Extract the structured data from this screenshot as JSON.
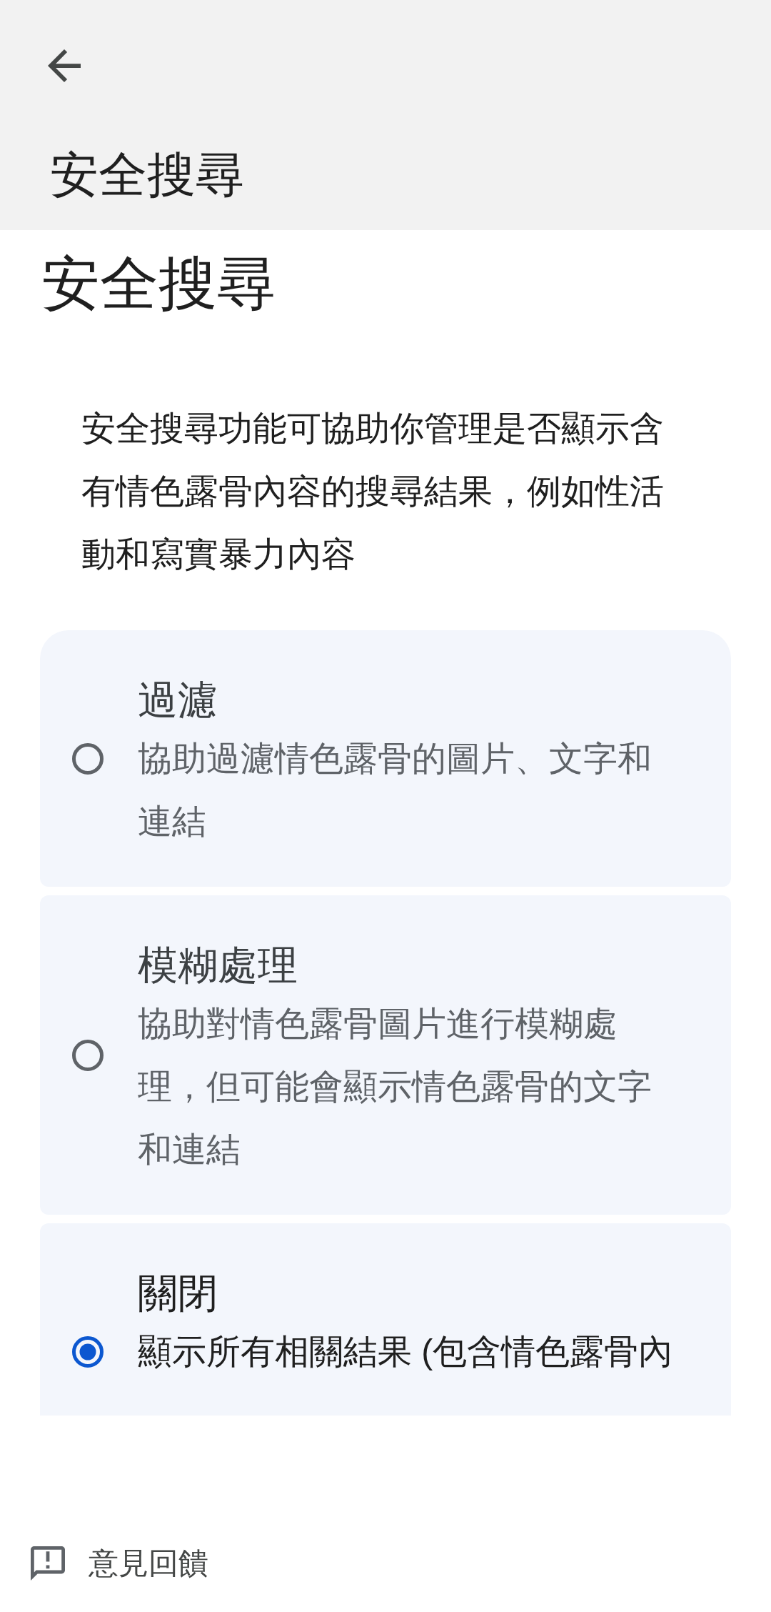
{
  "app_bar": {
    "title": "安全搜尋"
  },
  "page": {
    "heading": "安全搜尋",
    "description": "安全搜尋功能可協助你管理是否顯示含有情色露骨內容的搜尋結果，例如性活動和寫實暴力內容"
  },
  "options": [
    {
      "title": "過濾",
      "description": "協助過濾情色露骨的圖片、文字和連結",
      "selected": false
    },
    {
      "title": "模糊處理",
      "description": "協助對情色露骨圖片進行模糊處理，但可能會顯示情色露骨的文字和連結",
      "selected": false
    },
    {
      "title": "關閉",
      "description": "顯示所有相關結果 (包含情色露骨內",
      "selected": true
    }
  ],
  "footer": {
    "feedback": "意見回饋"
  }
}
